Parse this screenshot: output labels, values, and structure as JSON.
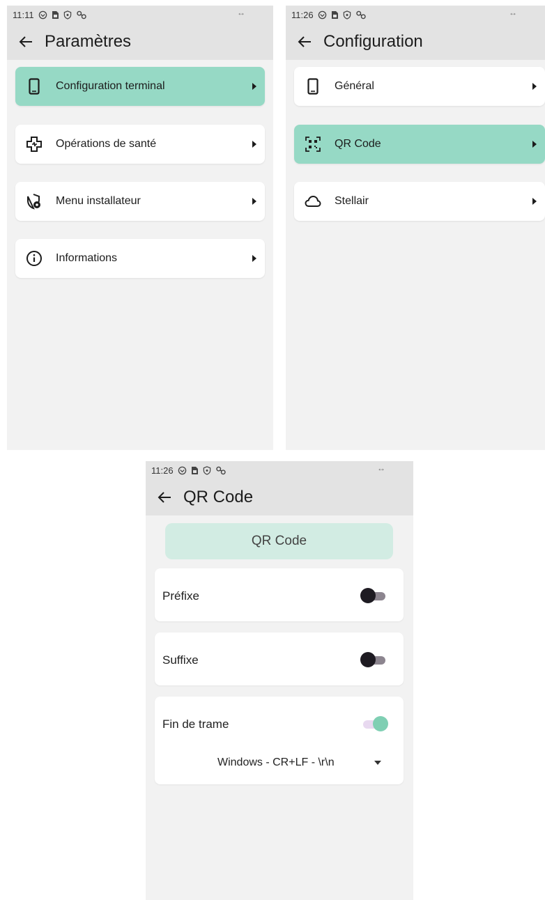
{
  "screen1": {
    "status_time": "11:11",
    "title": "Paramètres",
    "items": [
      {
        "label": "Configuration terminal",
        "icon": "phone-icon",
        "active": true
      },
      {
        "label": "Opérations de santé",
        "icon": "medical-cross-icon",
        "active": false
      },
      {
        "label": "Menu installateur",
        "icon": "shield-gear-icon",
        "active": false
      },
      {
        "label": "Informations",
        "icon": "info-icon",
        "active": false
      }
    ]
  },
  "screen2": {
    "status_time": "11:26",
    "title": "Configuration",
    "items": [
      {
        "label": "Général",
        "icon": "phone-icon",
        "active": false
      },
      {
        "label": "QR Code",
        "icon": "qr-scan-icon",
        "active": true
      },
      {
        "label": "Stellair",
        "icon": "cloud-icon",
        "active": false
      }
    ]
  },
  "screen3": {
    "status_time": "11:26",
    "title": "QR Code",
    "section_header": "QR Code",
    "prefix": {
      "label": "Préfixe",
      "enabled": false
    },
    "suffix": {
      "label": "Suffixe",
      "enabled": false
    },
    "end_of_frame": {
      "label": "Fin de trame",
      "enabled": true,
      "selected_option": "Windows - CR+LF - \\r\\n"
    }
  },
  "colors": {
    "accent": "#96d9c5",
    "header_accent": "#d2ece3",
    "appbar": "#e3e3e3",
    "background": "#f2f2f2"
  }
}
